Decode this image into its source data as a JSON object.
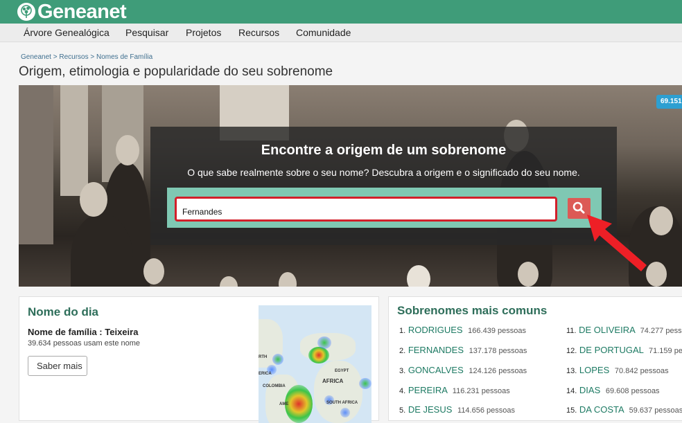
{
  "header": {
    "logo_text": "Geneanet",
    "brand_color": "#3f9c79"
  },
  "menu": [
    {
      "label": "Árvore Genealógica"
    },
    {
      "label": "Pesquisar"
    },
    {
      "label": "Projetos"
    },
    {
      "label": "Recursos"
    },
    {
      "label": "Comunidade"
    }
  ],
  "breadcrumb": [
    "Geneanet",
    "Recursos",
    "Nomes de Família"
  ],
  "breadcrumb_separator": " > ",
  "page_title": "Origem, etimologia e popularidade do seu sobrenome",
  "badge": "69.151",
  "search": {
    "title": "Encontre a origem de um sobrenome",
    "subtitle": "O que sabe realmente sobre o seu nome? Descubra a origem e o significado do seu nome.",
    "value": "Fernandes",
    "button_icon": "search-icon",
    "highlight_color": "#d21f2a"
  },
  "name_of_day": {
    "title": "Nome do dia",
    "name_line": "Nome de família : Teixeira",
    "description": "39.634 pessoas usam este nome",
    "button": "Saber mais",
    "map_labels": [
      "RTH",
      "ERICA",
      "COLOMBIA",
      "EGYPT",
      "AFRICA",
      "SOUTH AFRICA",
      "AME"
    ]
  },
  "common_surnames": {
    "title": "Sobrenomes mais comuns",
    "items": [
      {
        "rank": "1.",
        "name": "RODRIGUES",
        "count": "166.439 pessoas"
      },
      {
        "rank": "2.",
        "name": "FERNANDES",
        "count": "137.178 pessoas"
      },
      {
        "rank": "3.",
        "name": "GONCALVES",
        "count": "124.126 pessoas"
      },
      {
        "rank": "4.",
        "name": "PEREIRA",
        "count": "116.231 pessoas"
      },
      {
        "rank": "5.",
        "name": "DE JESUS",
        "count": "114.656 pessoas"
      },
      {
        "rank": "11.",
        "name": "DE OLIVEIRA",
        "count": "74.277 pessoas"
      },
      {
        "rank": "12.",
        "name": "DE PORTUGAL",
        "count": "71.159 pessoas"
      },
      {
        "rank": "13.",
        "name": "LOPES",
        "count": "70.842 pessoas"
      },
      {
        "rank": "14.",
        "name": "DIAS",
        "count": "69.608 pessoas"
      },
      {
        "rank": "15.",
        "name": "DA COSTA",
        "count": "59.637 pessoas"
      }
    ]
  }
}
